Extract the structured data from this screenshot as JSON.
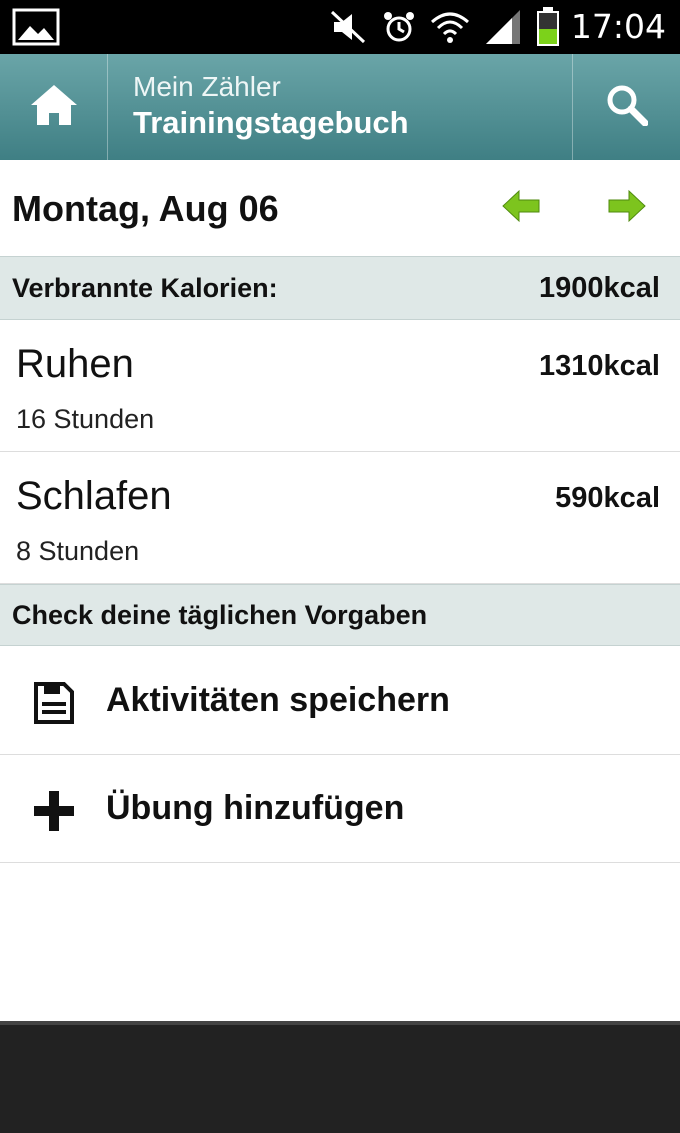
{
  "statusbar": {
    "time": "17:04",
    "icons": [
      "gallery-icon",
      "mute-icon",
      "alarm-icon",
      "wifi-icon",
      "signal-icon",
      "battery-icon"
    ]
  },
  "actionbar": {
    "subtitle": "Mein Zähler",
    "title": "Trainingstagebuch",
    "accent": "#4f8e93"
  },
  "date": {
    "label": "Montag, Aug 06"
  },
  "summary": {
    "label": "Verbrannte Kalorien:",
    "value": "1900kcal"
  },
  "activities": [
    {
      "name": "Ruhen",
      "duration": "16 Stunden",
      "kcal": "1310kcal"
    },
    {
      "name": "Schlafen",
      "duration": "8 Stunden",
      "kcal": "590kcal"
    }
  ],
  "goals": {
    "label": "Check deine täglichen Vorgaben"
  },
  "actions": {
    "save_label": "Aktivitäten speichern",
    "add_label": "Übung hinzufügen"
  },
  "colors": {
    "arrow_green": "#7dc41e",
    "section_bg": "#dfe8e7"
  }
}
